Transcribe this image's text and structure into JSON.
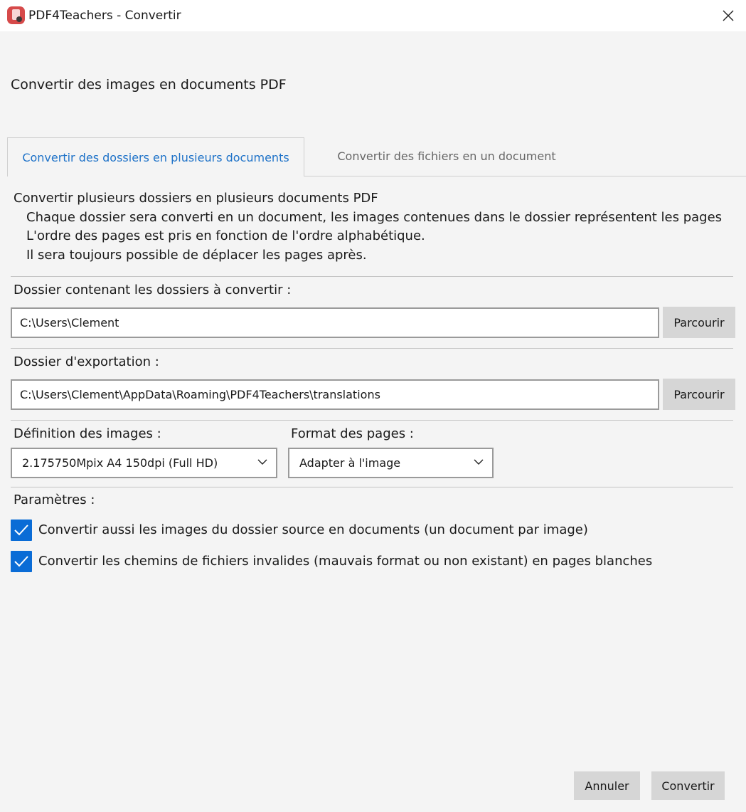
{
  "window": {
    "title": "PDF4Teachers - Convertir",
    "app_icon": "pdf4teachers-logo-icon",
    "close_icon": "close-icon"
  },
  "heading": "Convertir des images en documents PDF",
  "tabs": [
    {
      "label": "Convertir des dossiers en plusieurs documents",
      "active": true
    },
    {
      "label": "Convertir des fichiers en un document",
      "active": false
    }
  ],
  "description": {
    "line1": "Convertir plusieurs dossiers en plusieurs documents PDF",
    "line2": "Chaque dossier sera converti en un document, les images contenues dans le dossier représentent les pages",
    "line3": "L'ordre des pages est pris en fonction de l'ordre alphabétique.",
    "line4": "Il sera toujours possible de déplacer les pages après."
  },
  "source_folder": {
    "label": "Dossier contenant les dossiers à convertir :",
    "value": "C:\\Users\\Clement",
    "browse_label": "Parcourir"
  },
  "export_folder": {
    "label": "Dossier d'exportation :",
    "value": "C:\\Users\\Clement\\AppData\\Roaming\\PDF4Teachers\\translations",
    "browse_label": "Parcourir"
  },
  "definition": {
    "label": "Définition des images :",
    "selected": "2.175750Mpix A4 150dpi (Full HD)"
  },
  "page_format": {
    "label": "Format des pages :",
    "selected": "Adapter à l'image"
  },
  "settings": {
    "label": "Paramètres :",
    "options": [
      {
        "label": "Convertir aussi les images du dossier source en documents (un document par image)",
        "checked": true
      },
      {
        "label": "Convertir les chemins de fichiers invalides (mauvais format ou non existant) en pages blanches",
        "checked": true
      }
    ]
  },
  "footer": {
    "cancel_label": "Annuler",
    "convert_label": "Convertir"
  },
  "colors": {
    "accent": "#0a6cd6",
    "active_tab_text": "#1e72c8",
    "button_bg": "#d6d6d6",
    "window_bg": "#f4f4f4"
  }
}
